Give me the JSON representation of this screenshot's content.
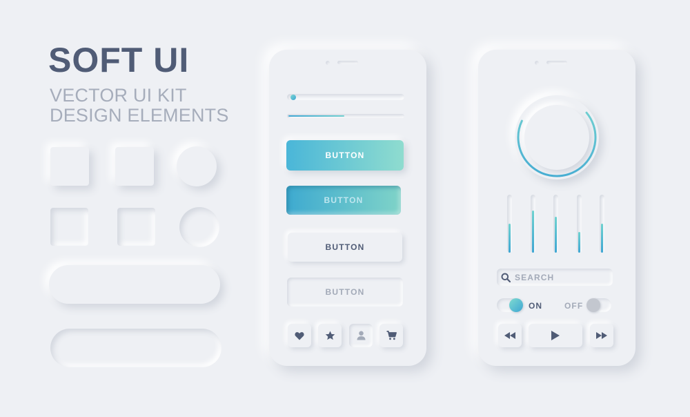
{
  "title": "SOFT UI",
  "subtitle_lines": [
    "VECTOR UI KIT",
    "DESIGN ELEMENTS"
  ],
  "colors": {
    "background": "#eef0f4",
    "title": "#505c76",
    "subtitle": "#a6adbb",
    "accent_start": "#4ab6d8",
    "accent_end": "#8fdccf",
    "icon": "#505c76"
  },
  "phone1": {
    "sliders": [
      {
        "progress": 0.03
      },
      {
        "progress": 0.49
      }
    ],
    "buttons": [
      {
        "label": "BUTTON",
        "style": "gradient-raised"
      },
      {
        "label": "BUTTON",
        "style": "gradient-pressed"
      },
      {
        "label": "BUTTON",
        "style": "raised"
      },
      {
        "label": "BUTTON",
        "style": "pressed"
      }
    ],
    "icon_buttons": [
      "heart-icon",
      "star-icon",
      "user-icon",
      "cart-icon"
    ]
  },
  "phone2": {
    "ring_progress": 0.68,
    "equalizer": [
      0.5,
      0.73,
      0.62,
      0.36,
      0.5
    ],
    "search": {
      "placeholder": "SEARCH"
    },
    "toggle_on": {
      "label": "ON",
      "state": true
    },
    "toggle_off": {
      "label": "OFF",
      "state": false
    },
    "media": [
      "rewind-icon",
      "play-icon",
      "fast-forward-icon"
    ]
  }
}
